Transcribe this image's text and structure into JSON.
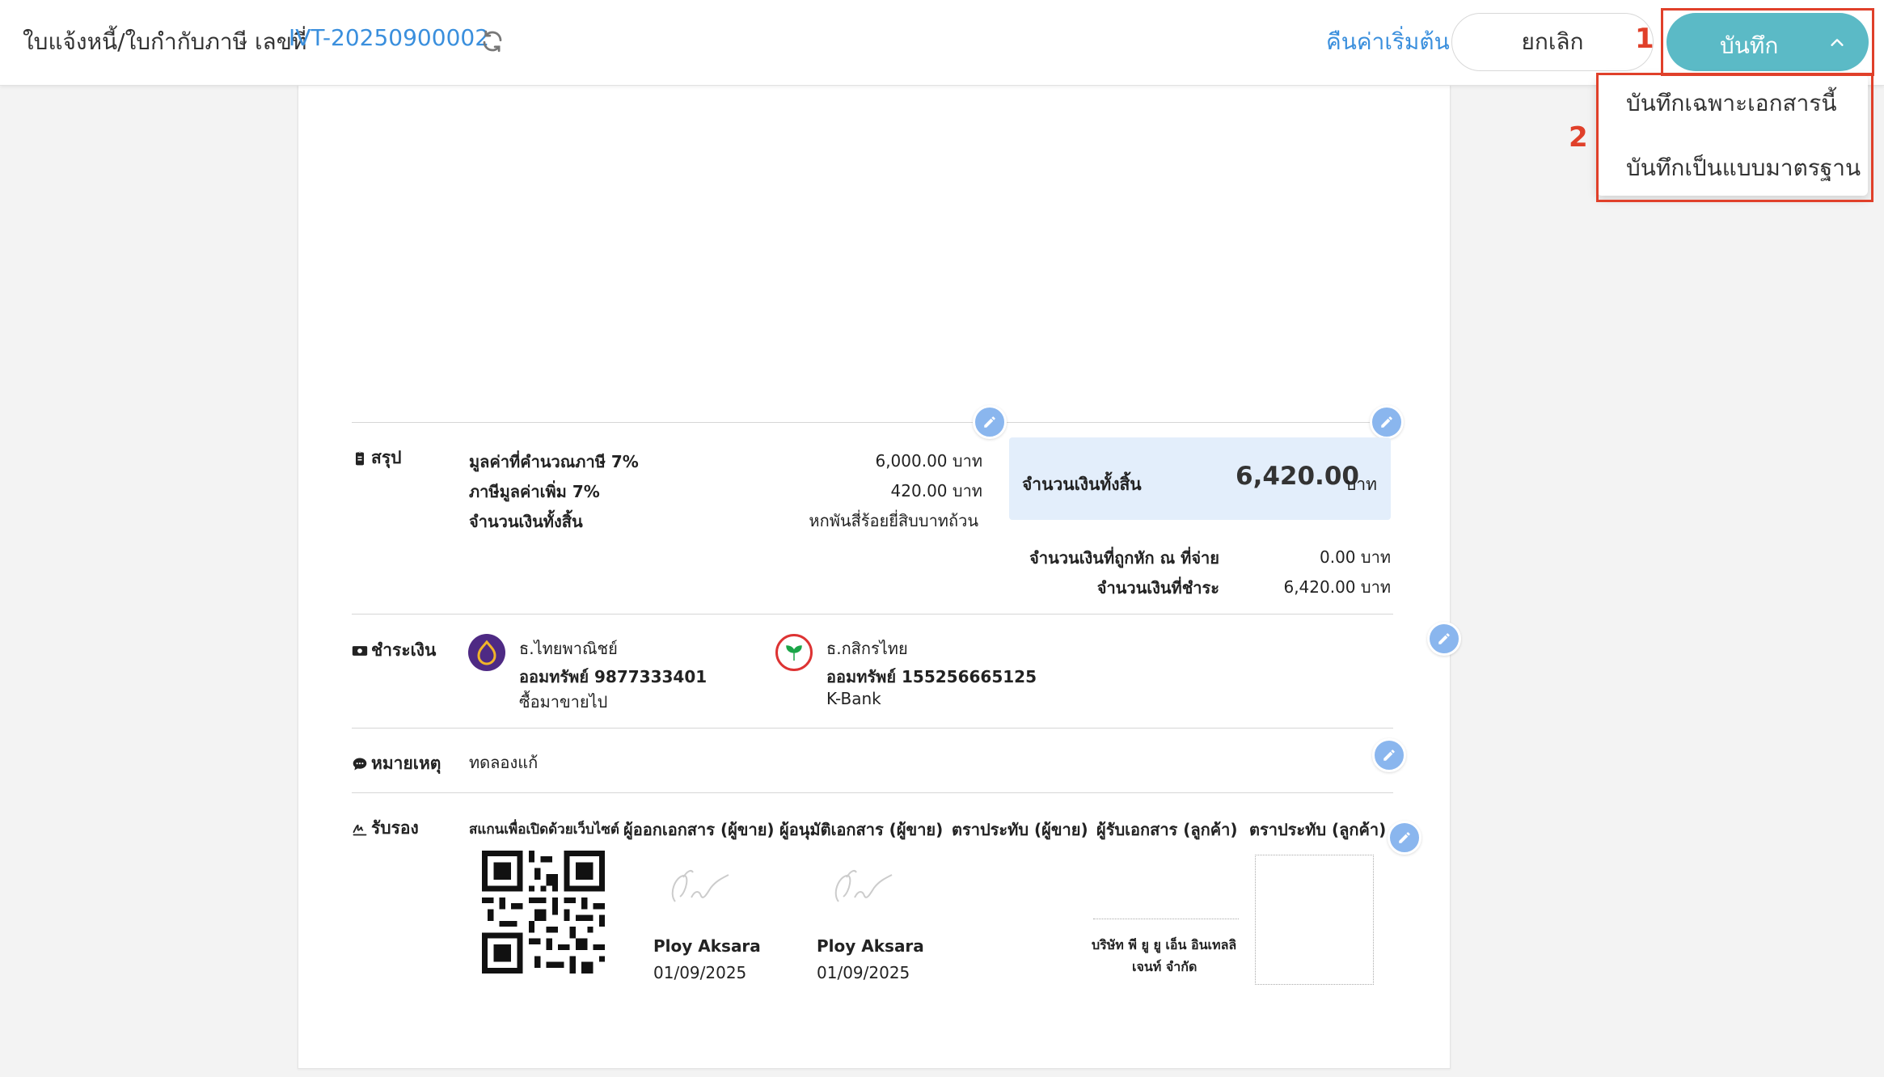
{
  "header": {
    "doc_title": "ใบแจ้งหนี้/ใบกำกับภาษี เลขที่",
    "doc_number": "IVT-20250900002",
    "reset_label": "คืนค่าเริ่มต้น",
    "cancel_label": "ยกเลิก",
    "save_label": "บันทึก"
  },
  "save_menu": {
    "items": [
      "บันทึกเฉพาะเอกสารนี้",
      "บันทึกเป็นแบบมาตรฐาน"
    ]
  },
  "annotations": {
    "one": "1",
    "two": "2"
  },
  "summary": {
    "section_label": "สรุป",
    "rows": [
      {
        "label": "มูลค่าที่คำนวณภาษี 7%",
        "value": "6,000.00 บาท"
      },
      {
        "label": "ภาษีมูลค่าเพิ่ม 7%",
        "value": "420.00 บาท"
      },
      {
        "label": "จำนวนเงินทั้งสิ้น",
        "value": "หกพันสี่ร้อยยี่สิบบาทถ้วน"
      }
    ],
    "total_label": "จำนวนเงินทั้งสิ้น",
    "total_amount": "6,420.00",
    "total_unit": "บาท",
    "withholding_label": "จำนวนเงินที่ถูกหัก ณ ที่จ่าย",
    "withholding_value": "0.00 บาท",
    "payable_label": "จำนวนเงินที่ชำระ",
    "payable_value": "6,420.00 บาท"
  },
  "payment": {
    "section_label": "ชำระเงิน",
    "banks": [
      {
        "name": "ธ.ไทยพาณิชย์",
        "account": "ออมทรัพย์ 9877333401",
        "holder": "ซื้อมาขายไป",
        "logo_color": "#4e2a84"
      },
      {
        "name": "ธ.กสิกรไทย",
        "account": "ออมทรัพย์ 155256665125",
        "holder": "K-Bank",
        "logo_color": "#1ba548"
      }
    ]
  },
  "remark": {
    "section_label": "หมายเหตุ",
    "text": "ทดลองแก้"
  },
  "approval": {
    "section_label": "รับรอง",
    "columns": [
      "สแกนเพื่อเปิดด้วยเว็บไซต์",
      "ผู้ออกเอกสาร (ผู้ขาย)",
      "ผู้อนุมัติเอกสาร (ผู้ขาย)",
      "ตราประทับ (ผู้ขาย)",
      "ผู้รับเอกสาร (ลูกค้า)",
      "ตราประทับ (ลูกค้า)"
    ],
    "issuer_name": "Ploy Aksara",
    "issuer_date": "01/09/2025",
    "approver_name": "Ploy Aksara",
    "approver_date": "01/09/2025",
    "receiver_company_line1": "บริษัท พี ยู ยู เอ็น อินเทลลิ",
    "receiver_company_line2": "เจนท์ จำกัด"
  },
  "colors": {
    "accent": "#5bbac6",
    "link": "#3a8fdd",
    "annotation": "#e0402a",
    "edit": "#8ab6ee"
  }
}
